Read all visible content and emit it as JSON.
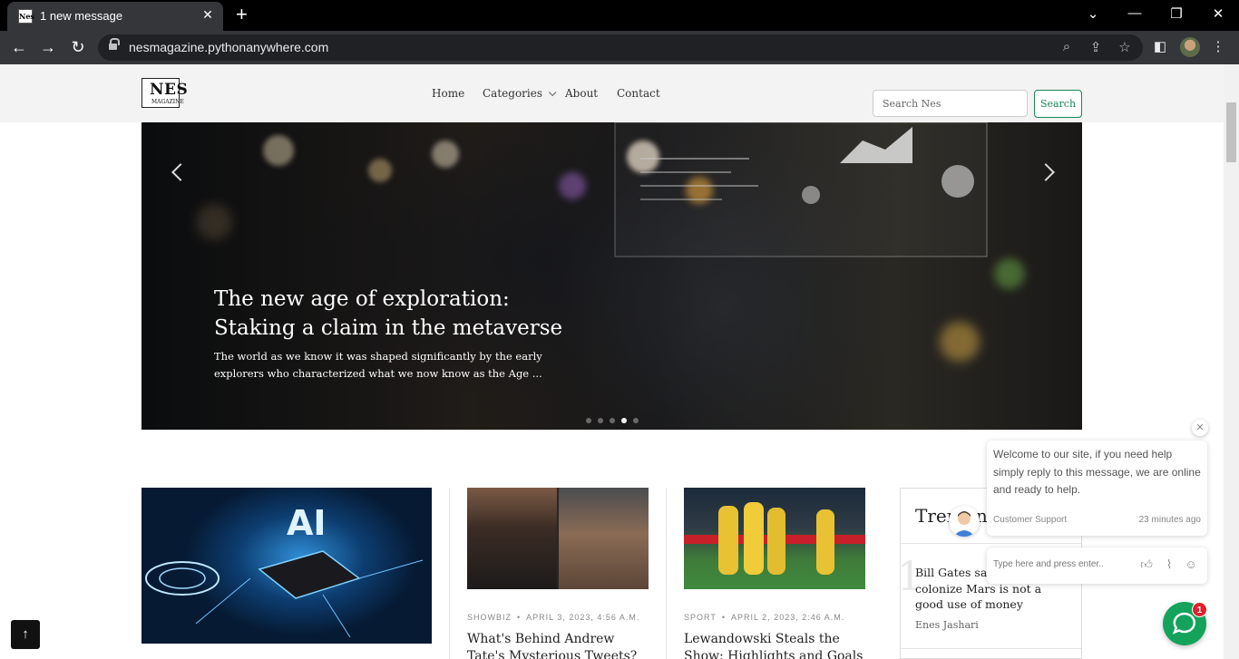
{
  "browser": {
    "tab_title": "1 new message",
    "tab_favicon_text": "Nes",
    "url": "nesmagazine.pythonanywhere.com"
  },
  "site": {
    "logo": {
      "main": "NES",
      "sub": "MAGAZINE"
    },
    "nav": [
      {
        "label": "Home"
      },
      {
        "label": "Categories"
      },
      {
        "label": "About"
      },
      {
        "label": "Contact"
      }
    ],
    "search": {
      "placeholder": "Search Nes",
      "button": "Search"
    }
  },
  "hero": {
    "title": "The new age of exploration: Staking a claim in the metaverse",
    "excerpt": "The world as we know it was shaped significantly by the early explorers who characterized what we now know as the Age ...",
    "slide_count": 5,
    "active_slide": 4
  },
  "articles": [
    {
      "category": "",
      "date": "",
      "title": ""
    },
    {
      "category": "SHOWBIZ",
      "date": "APRIL 3, 2023, 4:56 A.M.",
      "title": "What's Behind Andrew Tate's Mysterious Tweets? The"
    },
    {
      "category": "SPORT",
      "date": "APRIL 2, 2023, 2:46 A.M.",
      "title": "Lewandowski Steals the Show: Highlights and Goals from"
    }
  ],
  "trending": {
    "heading": "Trending",
    "items": [
      {
        "number": "1",
        "title": "Bill Gates says ambition to colonize Mars is not a good use of money",
        "author": "Enes Jashari"
      }
    ]
  },
  "chat": {
    "message": "Welcome to our site, if you need help simply reply to this message, we are online and ready to help.",
    "from": "Customer Support",
    "time": "23 minutes ago",
    "input_placeholder": "Type here and press enter..",
    "badge_count": "1",
    "accent": "#13a35a"
  },
  "colors": {
    "search_green": "#198754",
    "badge_red": "#e0202c"
  }
}
